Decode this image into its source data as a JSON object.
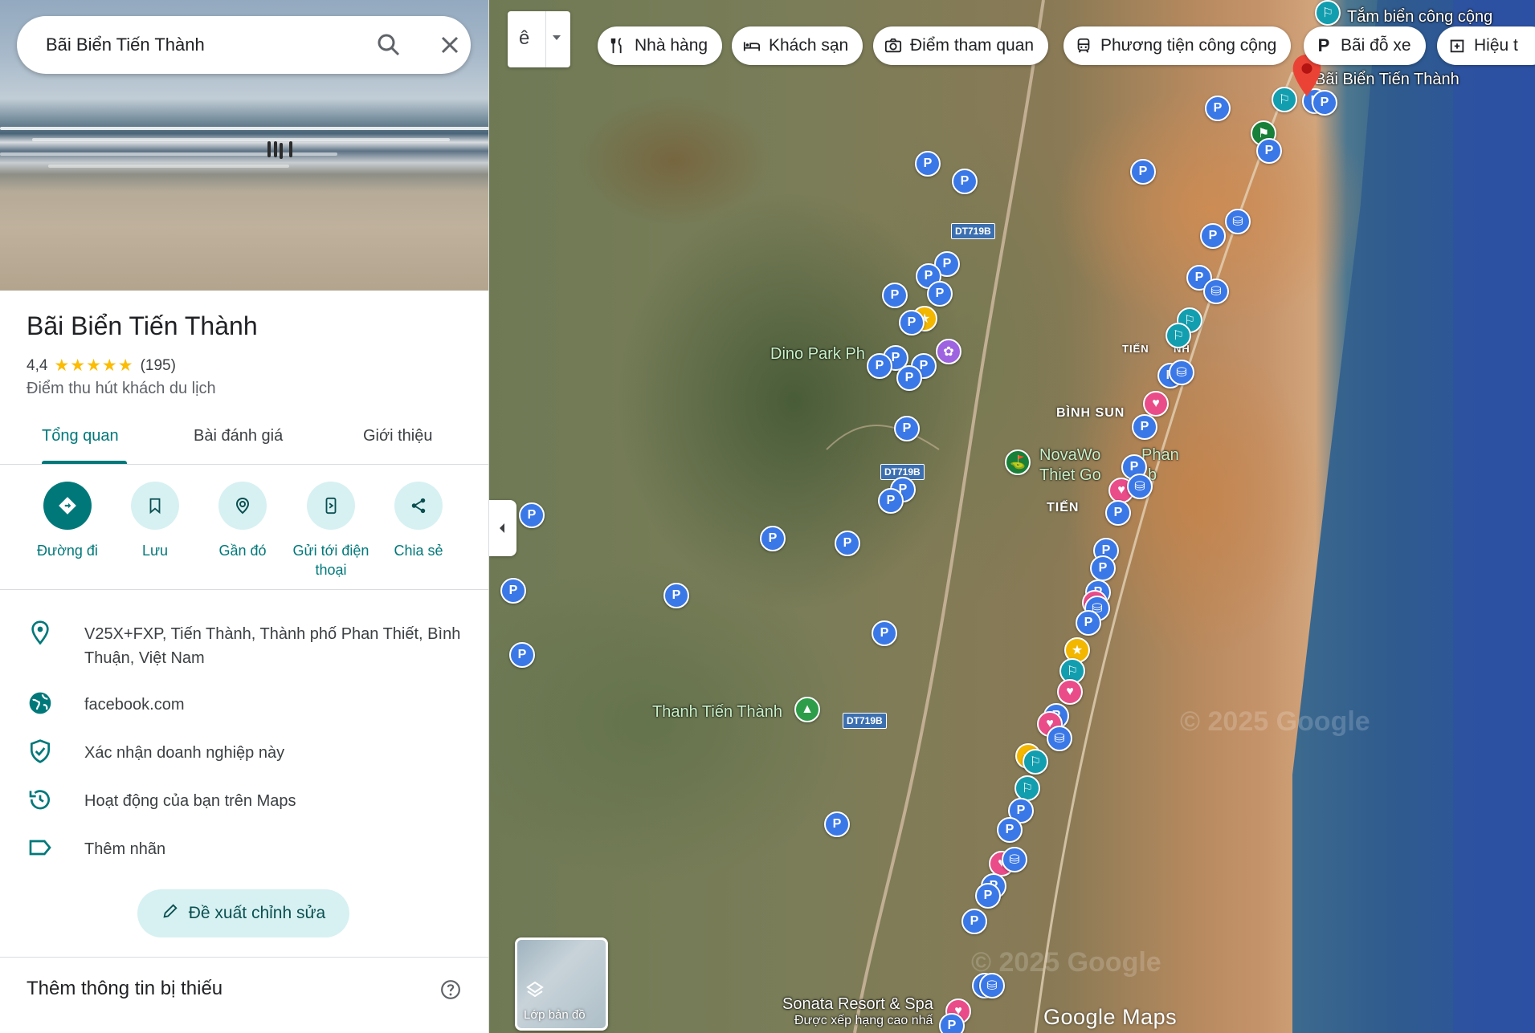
{
  "search": {
    "value": "Bãi Biển Tiến Thành"
  },
  "place": {
    "title": "Bãi Biển Tiến Thành",
    "rating": "4,4",
    "stars": "★★★★★",
    "review_count": "(195)",
    "category": "Điểm thu hút khách du lịch"
  },
  "tabs": [
    {
      "label": "Tổng quan",
      "active": true
    },
    {
      "label": "Bài đánh giá",
      "active": false
    },
    {
      "label": "Giới thiệu",
      "active": false
    }
  ],
  "actions": [
    {
      "label": "Đường đi",
      "icon": "directions-icon"
    },
    {
      "label": "Lưu",
      "icon": "bookmark-icon"
    },
    {
      "label": "Gần đó",
      "icon": "nearby-icon"
    },
    {
      "label": "Gửi tới điện thoại",
      "icon": "send-to-phone-icon"
    },
    {
      "label": "Chia sẻ",
      "icon": "share-icon"
    }
  ],
  "info": {
    "address": "V25X+FXP, Tiến Thành, Thành phố Phan Thiết, Bình Thuận, Việt Nam",
    "website": "facebook.com",
    "claim": "Xác nhận doanh nghiệp này",
    "activity": "Hoạt động của bạn trên Maps",
    "label": "Thêm nhãn"
  },
  "suggest_edit": "Đề xuất chỉnh sửa",
  "missing_info": "Thêm thông tin bị thiếu",
  "map": {
    "lang_label": "ê",
    "chips": [
      {
        "label": "Nhà hàng",
        "icon": "restaurant-icon"
      },
      {
        "label": "Khách sạn",
        "icon": "hotel-icon"
      },
      {
        "label": "Điểm tham quan",
        "icon": "camera-icon"
      },
      {
        "label": "Phương tiện công cộng",
        "icon": "transit-icon"
      },
      {
        "label": "Bãi đỗ xe",
        "icon": "parking-icon"
      },
      {
        "label": "Hiệu t",
        "icon": "pharmacy-icon"
      }
    ],
    "labels": {
      "selected_place": "Bãi Biển Tiến Thành",
      "public_bath": "Tắm biển công cộng",
      "dino_park": "Dino Park Ph",
      "novaworld_1": "NovaWo",
      "novaworld_2": "Phan",
      "novaworld_3": "Thiet Go",
      "novaworld_4": "b",
      "thanh_tien_thanh": "Thanh Tiến Thành",
      "sonata": "Sonata Resort & Spa",
      "sonata_sub": "Được xếp hạng cao nhấ",
      "tien_thanh_area": "TIẾN",
      "tien_thanh_area2": "NH",
      "binh_sun": "BÌNH SUN",
      "tien_small": "TIẾN"
    },
    "road_shields": [
      "DT719B",
      "DT719B",
      "DT719B"
    ],
    "watermarks": [
      "© 2025 Google",
      "© 2025 Google"
    ],
    "layers_label": "Lớp bản đồ",
    "logo": "Google Maps"
  }
}
